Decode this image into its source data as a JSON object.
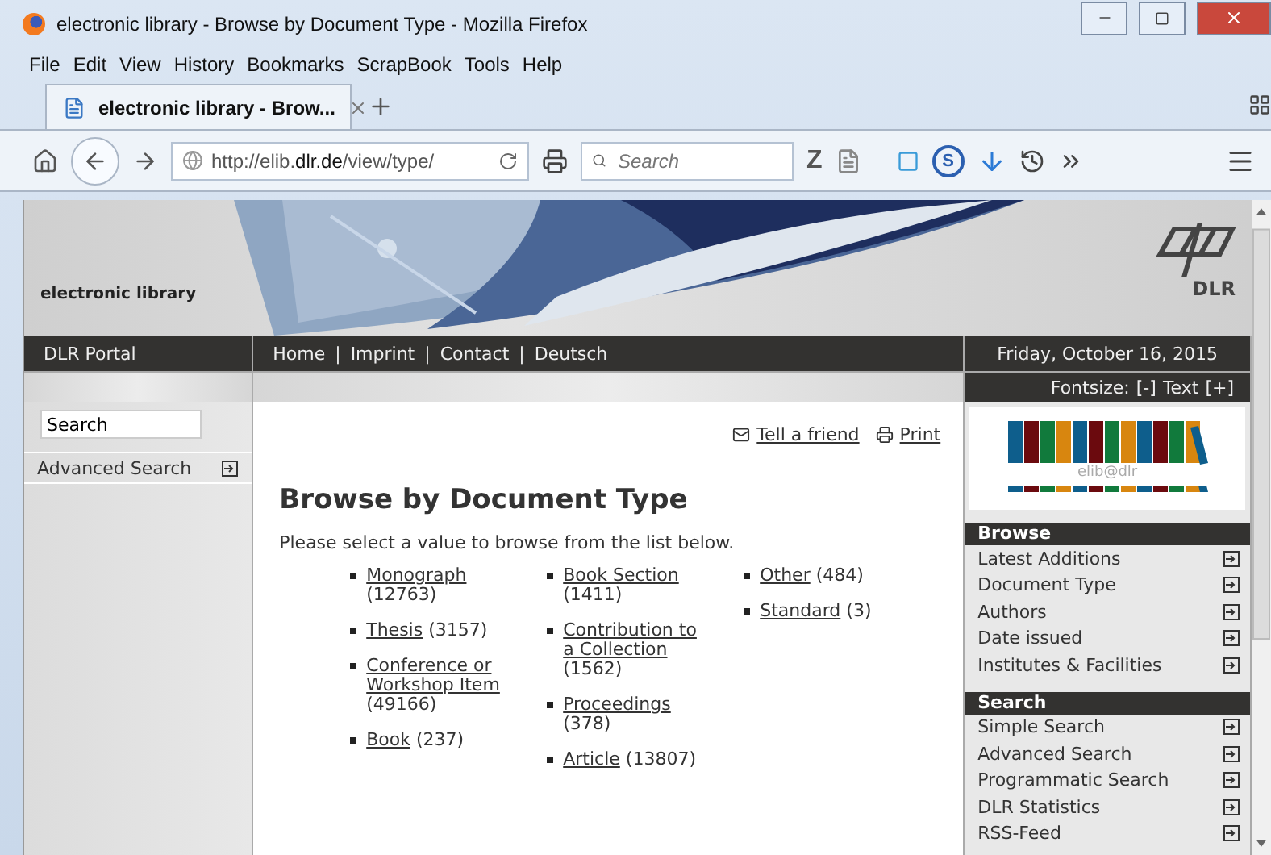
{
  "window": {
    "title": "electronic library - Browse by Document Type - Mozilla Firefox"
  },
  "menu": [
    "File",
    "Edit",
    "View",
    "History",
    "Bookmarks",
    "ScrapBook",
    "Tools",
    "Help"
  ],
  "tabs": [
    {
      "label": "electronic library - Brow...",
      "selected": true
    }
  ],
  "address": {
    "url": "http://elib.**dlr.de**/view/type/"
  },
  "search_bar": {
    "placeholder": "Search"
  },
  "toolbar_glyphs": {
    "z": "Z",
    "s": "S"
  },
  "site": {
    "title": "electronic library",
    "logo_text": "DLR"
  },
  "portal": "DLR Portal",
  "nav": {
    "links": [
      "Home",
      "Imprint",
      "Contact",
      "Deutsch"
    ],
    "separator": "|"
  },
  "date": "Friday, October 16, 2015",
  "fontsize": {
    "label": "Fontsize:",
    "decrease": "[-]",
    "text": "Text",
    "increase": "[+]"
  },
  "left_search": {
    "value": "Search"
  },
  "left_links": [
    "Advanced Search"
  ],
  "actions": [
    {
      "kind": "mail",
      "label": "Tell a friend"
    },
    {
      "kind": "print",
      "label": "Print"
    }
  ],
  "heading": "Browse by Document Type",
  "intro": "Please select a value to browse from the list below.",
  "columns": [
    [
      {
        "label": "Monograph",
        "count": "(12763)"
      },
      {
        "label": "Thesis",
        "count": "(3157)"
      },
      {
        "label": "Conference or Workshop Item",
        "count": "(49166)"
      },
      {
        "label": "Book",
        "count": "(237)"
      }
    ],
    [
      {
        "label": "Book Section",
        "count": "(1411)"
      },
      {
        "label": "Contribution to a Collection",
        "count": "(1562)"
      },
      {
        "label": "Proceedings",
        "count": "(378)"
      },
      {
        "label": "Article",
        "count": "(13807)"
      }
    ],
    [
      {
        "label": "Other",
        "count": "(484)"
      },
      {
        "label": "Standard",
        "count": "(3)"
      }
    ]
  ],
  "elib_logo": {
    "text": "elib@dlr"
  },
  "sidebar_sections": [
    {
      "title": "Browse",
      "items": [
        "Latest Additions",
        "Document Type",
        "Authors",
        "Date issued",
        "Institutes & Facilities"
      ]
    },
    {
      "title": "Search",
      "items": [
        "Simple Search",
        "Advanced Search",
        "Programmatic Search",
        "DLR Statistics",
        "RSS-Feed"
      ]
    }
  ]
}
